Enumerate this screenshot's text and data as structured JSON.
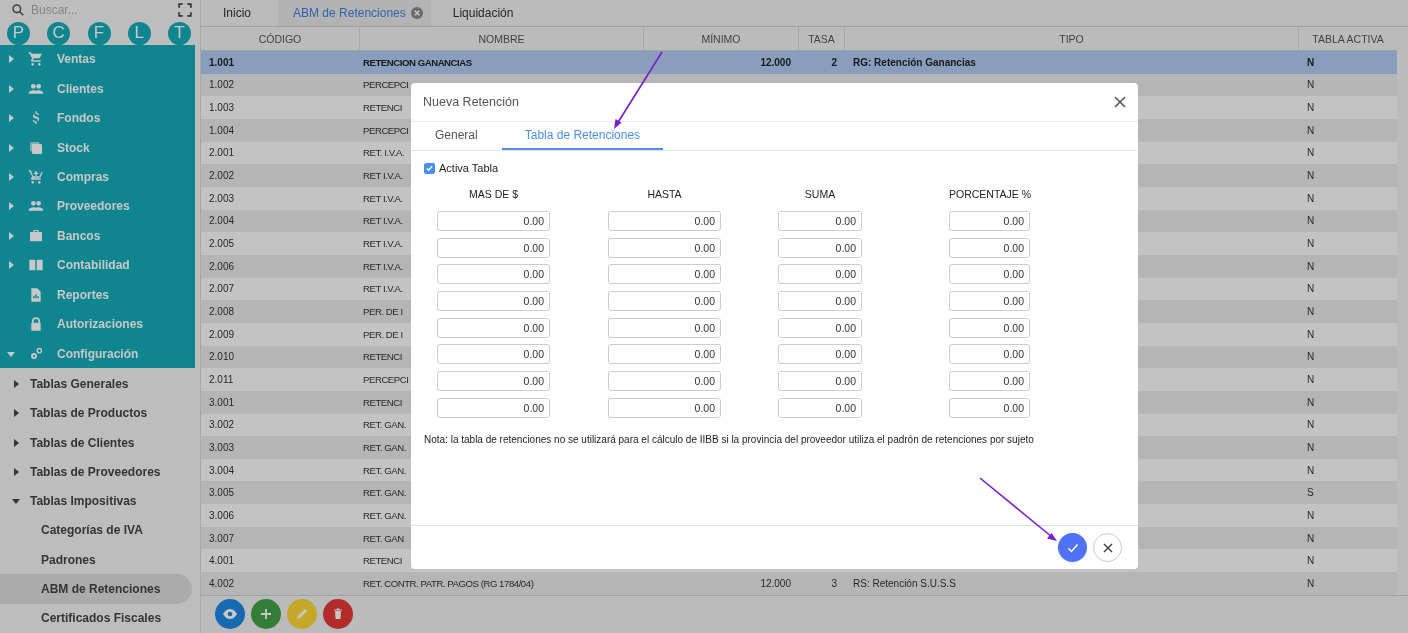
{
  "sidebar": {
    "search": {
      "placeholder": "Buscar..."
    },
    "shortcuts": [
      "P",
      "C",
      "F",
      "L",
      "T"
    ],
    "menu": [
      {
        "label": "Ventas",
        "expanded": false
      },
      {
        "label": "Clientes",
        "expanded": false
      },
      {
        "label": "Fondos",
        "expanded": false
      },
      {
        "label": "Stock",
        "expanded": false
      },
      {
        "label": "Compras",
        "expanded": false
      },
      {
        "label": "Proveedores",
        "expanded": false
      },
      {
        "label": "Bancos",
        "expanded": false
      },
      {
        "label": "Contabilidad",
        "expanded": false
      },
      {
        "label": "Reportes"
      },
      {
        "label": "Autorizaciones"
      },
      {
        "label": "Configuración",
        "expanded": true,
        "children": [
          {
            "label": "Tablas Generales",
            "expanded": false
          },
          {
            "label": "Tablas de Productos",
            "expanded": false
          },
          {
            "label": "Tablas de Clientes",
            "expanded": false
          },
          {
            "label": "Tablas de Proveedores",
            "expanded": false
          },
          {
            "label": "Tablas Impositivas",
            "expanded": true,
            "children": [
              {
                "label": "Categorías de IVA",
                "selected": false
              },
              {
                "label": "Padrones",
                "selected": false
              },
              {
                "label": "ABM de Retenciones",
                "selected": true
              },
              {
                "label": "Certificados Fiscales",
                "selected": false
              }
            ]
          }
        ]
      }
    ]
  },
  "tabs": [
    {
      "label": "Inicio",
      "selected": false
    },
    {
      "label": "ABM de Retenciones",
      "selected": true
    },
    {
      "label": "Liquidación",
      "selected": false
    }
  ],
  "table": {
    "columns": [
      "CÓDIGO",
      "NOMBRE",
      "MÍNIMO",
      "TASA",
      "TIPO",
      "TABLA ACTIVA"
    ],
    "rows": [
      {
        "selected": true,
        "codigo": "1.001",
        "nombre": "RETENCION GANANCIAS",
        "minimo": "12.000",
        "tasa": "2",
        "tipo": "RG: Retención Ganancias",
        "tabla_activa": "N"
      },
      {
        "selected": false,
        "codigo": "1.002",
        "nombre": "PERCEPCI",
        "tabla_activa": "N"
      },
      {
        "selected": false,
        "codigo": "1.003",
        "nombre": "RETENCI",
        "tabla_activa": "N"
      },
      {
        "selected": false,
        "codigo": "1.004",
        "nombre": "PERCEPCI",
        "tabla_activa": "N"
      },
      {
        "selected": false,
        "codigo": "2.001",
        "nombre": "RET. I.V.A.",
        "tabla_activa": "N"
      },
      {
        "selected": false,
        "codigo": "2.002",
        "nombre": "RET I.V.A.",
        "tabla_activa": "N"
      },
      {
        "selected": false,
        "codigo": "2.003",
        "nombre": "RET I.V.A.",
        "tabla_activa": "N"
      },
      {
        "selected": false,
        "codigo": "2.004",
        "nombre": "RET I.V.A.",
        "tabla_activa": "N"
      },
      {
        "selected": false,
        "codigo": "2.005",
        "nombre": "RET I.V.A.",
        "tabla_activa": "N"
      },
      {
        "selected": false,
        "codigo": "2.006",
        "nombre": "RET I.V.A.",
        "tabla_activa": "N"
      },
      {
        "selected": false,
        "codigo": "2.007",
        "nombre": "RET I.V.A.",
        "tabla_activa": "N"
      },
      {
        "selected": false,
        "codigo": "2.008",
        "nombre": "PER. DE I",
        "tabla_activa": "N"
      },
      {
        "selected": false,
        "codigo": "2.009",
        "nombre": "PER. DE I",
        "tabla_activa": "N"
      },
      {
        "selected": false,
        "codigo": "2.010",
        "nombre": "RETENCI",
        "tabla_activa": "N"
      },
      {
        "selected": false,
        "codigo": "2.011",
        "nombre": "PERCEPCI",
        "tabla_activa": "N"
      },
      {
        "selected": false,
        "codigo": "3.001",
        "nombre": "RETENCI",
        "tabla_activa": "N"
      },
      {
        "selected": false,
        "codigo": "3.002",
        "nombre": "RET. GAN.",
        "tabla_activa": "N"
      },
      {
        "selected": false,
        "codigo": "3.003",
        "nombre": "RET. GAN.",
        "tabla_activa": "N"
      },
      {
        "selected": false,
        "codigo": "3.004",
        "nombre": "RET. GAN.",
        "tabla_activa": "N"
      },
      {
        "selected": false,
        "codigo": "3.005",
        "nombre": "RET. GAN.",
        "tabla_activa": "S"
      },
      {
        "selected": false,
        "codigo": "3.006",
        "nombre": "RET. GAN.",
        "tabla_activa": "N"
      },
      {
        "selected": false,
        "codigo": "3.007",
        "nombre": "RET. GAN",
        "tabla_activa": "N"
      },
      {
        "selected": false,
        "codigo": "4.001",
        "nombre": "RETENCI",
        "tabla_activa": "N"
      },
      {
        "selected": false,
        "codigo": "4.002",
        "nombre": "RET. CONTR. PATR. PAGOS (RG 1784/04)",
        "minimo": "12.000",
        "tasa": "3",
        "tipo": "RS: Retención S.U.S.S",
        "tabla_activa": "N"
      }
    ]
  },
  "dialog": {
    "title": "Nueva Retención",
    "tabs": [
      {
        "label": "General",
        "selected": false
      },
      {
        "label": "Tabla de Retenciones",
        "selected": true
      }
    ],
    "active_table": {
      "label": "Activa Tabla",
      "checked": true
    },
    "columns": [
      "MAS DE $",
      "HASTA",
      "SUMA",
      "PORCENTAJE %"
    ],
    "rows": [
      [
        "0.00",
        "0.00",
        "0.00",
        "0.00"
      ],
      [
        "0.00",
        "0.00",
        "0.00",
        "0.00"
      ],
      [
        "0.00",
        "0.00",
        "0.00",
        "0.00"
      ],
      [
        "0.00",
        "0.00",
        "0.00",
        "0.00"
      ],
      [
        "0.00",
        "0.00",
        "0.00",
        "0.00"
      ],
      [
        "0.00",
        "0.00",
        "0.00",
        "0.00"
      ],
      [
        "0.00",
        "0.00",
        "0.00",
        "0.00"
      ],
      [
        "0.00",
        "0.00",
        "0.00",
        "0.00"
      ]
    ],
    "note": "Nota: la tabla de retenciones no se utilizará para el cálculo de IIBB si la provincia del proveedor utiliza el padrón de retenciones por sujeto"
  }
}
